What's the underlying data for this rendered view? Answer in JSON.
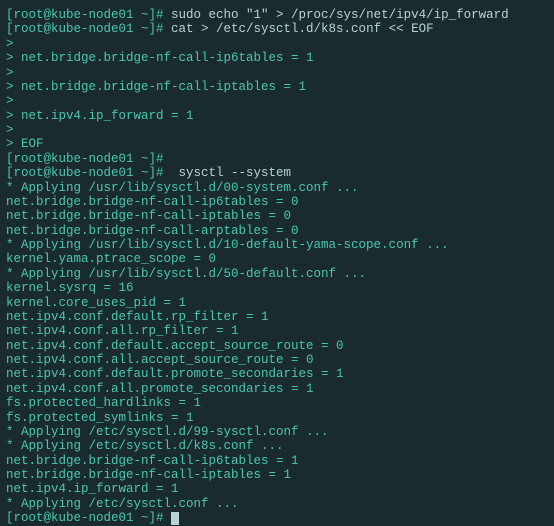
{
  "lines": [
    {
      "prompt": "[root@kube-node01 ~]# ",
      "cmd": "sudo echo \"1\" > /proc/sys/net/ipv4/ip_forward"
    },
    {
      "prompt": "[root@kube-node01 ~]# ",
      "cmd": "cat > /etc/sysctl.d/k8s.conf << EOF"
    },
    {
      "text": ">"
    },
    {
      "text": "> net.bridge.bridge-nf-call-ip6tables = 1"
    },
    {
      "text": ">"
    },
    {
      "text": "> net.bridge.bridge-nf-call-iptables = 1"
    },
    {
      "text": ">"
    },
    {
      "text": "> net.ipv4.ip_forward = 1"
    },
    {
      "text": ">"
    },
    {
      "text": "> EOF"
    },
    {
      "prompt": "[root@kube-node01 ~]#",
      "cmd": ""
    },
    {
      "prompt": "[root@kube-node01 ~]#  ",
      "cmd": "sysctl --system"
    },
    {
      "text": "* Applying /usr/lib/sysctl.d/00-system.conf ..."
    },
    {
      "text": "net.bridge.bridge-nf-call-ip6tables = 0"
    },
    {
      "text": "net.bridge.bridge-nf-call-iptables = 0"
    },
    {
      "text": "net.bridge.bridge-nf-call-arptables = 0"
    },
    {
      "text": "* Applying /usr/lib/sysctl.d/10-default-yama-scope.conf ..."
    },
    {
      "text": "kernel.yama.ptrace_scope = 0"
    },
    {
      "text": "* Applying /usr/lib/sysctl.d/50-default.conf ..."
    },
    {
      "text": "kernel.sysrq = 16"
    },
    {
      "text": "kernel.core_uses_pid = 1"
    },
    {
      "text": "net.ipv4.conf.default.rp_filter = 1"
    },
    {
      "text": "net.ipv4.conf.all.rp_filter = 1"
    },
    {
      "text": "net.ipv4.conf.default.accept_source_route = 0"
    },
    {
      "text": "net.ipv4.conf.all.accept_source_route = 0"
    },
    {
      "text": "net.ipv4.conf.default.promote_secondaries = 1"
    },
    {
      "text": "net.ipv4.conf.all.promote_secondaries = 1"
    },
    {
      "text": "fs.protected_hardlinks = 1"
    },
    {
      "text": "fs.protected_symlinks = 1"
    },
    {
      "text": "* Applying /etc/sysctl.d/99-sysctl.conf ..."
    },
    {
      "text": "* Applying /etc/sysctl.d/k8s.conf ..."
    },
    {
      "text": "net.bridge.bridge-nf-call-ip6tables = 1"
    },
    {
      "text": "net.bridge.bridge-nf-call-iptables = 1"
    },
    {
      "text": "net.ipv4.ip_forward = 1"
    },
    {
      "text": "* Applying /etc/sysctl.conf ..."
    },
    {
      "prompt": "[root@kube-node01 ~]# ",
      "cmd": "",
      "cursor": true
    }
  ]
}
